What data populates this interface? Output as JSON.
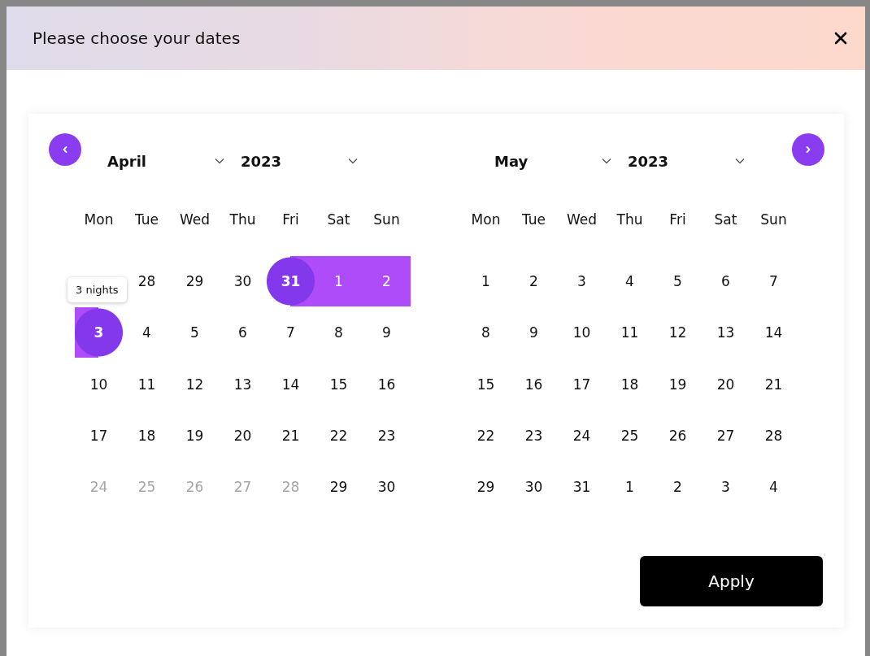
{
  "dialog": {
    "title": "Please choose your dates"
  },
  "months": [
    {
      "month": "April",
      "year": "2023",
      "weekdays": [
        "Mon",
        "Tue",
        "Wed",
        "Thu",
        "Fri",
        "Sat",
        "Sun"
      ],
      "weeks": [
        [
          {
            "kind": "covered"
          },
          {
            "kind": "day",
            "label": "28",
            "selected": false,
            "in_range": false,
            "disabled": false
          },
          {
            "kind": "day",
            "label": "29",
            "selected": false,
            "in_range": false,
            "disabled": false
          },
          {
            "kind": "day",
            "label": "30",
            "selected": false,
            "in_range": false,
            "disabled": false
          },
          {
            "kind": "day",
            "label": "31",
            "selected": true,
            "in_range": true,
            "disabled": false
          },
          {
            "kind": "day",
            "label": "1",
            "selected": false,
            "in_range": true,
            "disabled": false
          },
          {
            "kind": "day",
            "label": "2",
            "selected": false,
            "in_range": true,
            "disabled": false
          }
        ],
        [
          {
            "kind": "day",
            "label": "3",
            "selected": true,
            "in_range": true,
            "disabled": false,
            "tooltip": "3 nights"
          },
          {
            "kind": "day",
            "label": "4",
            "selected": false,
            "in_range": false,
            "disabled": false
          },
          {
            "kind": "day",
            "label": "5",
            "selected": false,
            "in_range": false,
            "disabled": false
          },
          {
            "kind": "day",
            "label": "6",
            "selected": false,
            "in_range": false,
            "disabled": false
          },
          {
            "kind": "day",
            "label": "7",
            "selected": false,
            "in_range": false,
            "disabled": false
          },
          {
            "kind": "day",
            "label": "8",
            "selected": false,
            "in_range": false,
            "disabled": false
          },
          {
            "kind": "day",
            "label": "9",
            "selected": false,
            "in_range": false,
            "disabled": false
          }
        ],
        [
          {
            "kind": "day",
            "label": "10",
            "selected": false,
            "in_range": false,
            "disabled": false
          },
          {
            "kind": "day",
            "label": "11",
            "selected": false,
            "in_range": false,
            "disabled": false
          },
          {
            "kind": "day",
            "label": "12",
            "selected": false,
            "in_range": false,
            "disabled": false
          },
          {
            "kind": "day",
            "label": "13",
            "selected": false,
            "in_range": false,
            "disabled": false
          },
          {
            "kind": "day",
            "label": "14",
            "selected": false,
            "in_range": false,
            "disabled": false
          },
          {
            "kind": "day",
            "label": "15",
            "selected": false,
            "in_range": false,
            "disabled": false
          },
          {
            "kind": "day",
            "label": "16",
            "selected": false,
            "in_range": false,
            "disabled": false
          }
        ],
        [
          {
            "kind": "day",
            "label": "17",
            "selected": false,
            "in_range": false,
            "disabled": false
          },
          {
            "kind": "day",
            "label": "18",
            "selected": false,
            "in_range": false,
            "disabled": false
          },
          {
            "kind": "day",
            "label": "19",
            "selected": false,
            "in_range": false,
            "disabled": false
          },
          {
            "kind": "day",
            "label": "20",
            "selected": false,
            "in_range": false,
            "disabled": false
          },
          {
            "kind": "day",
            "label": "21",
            "selected": false,
            "in_range": false,
            "disabled": false
          },
          {
            "kind": "day",
            "label": "22",
            "selected": false,
            "in_range": false,
            "disabled": false
          },
          {
            "kind": "day",
            "label": "23",
            "selected": false,
            "in_range": false,
            "disabled": false
          }
        ],
        [
          {
            "kind": "day",
            "label": "24",
            "selected": false,
            "in_range": false,
            "disabled": true
          },
          {
            "kind": "day",
            "label": "25",
            "selected": false,
            "in_range": false,
            "disabled": true
          },
          {
            "kind": "day",
            "label": "26",
            "selected": false,
            "in_range": false,
            "disabled": true
          },
          {
            "kind": "day",
            "label": "27",
            "selected": false,
            "in_range": false,
            "disabled": true
          },
          {
            "kind": "day",
            "label": "28",
            "selected": false,
            "in_range": false,
            "disabled": true
          },
          {
            "kind": "day",
            "label": "29",
            "selected": false,
            "in_range": false,
            "disabled": false
          },
          {
            "kind": "day",
            "label": "30",
            "selected": false,
            "in_range": false,
            "disabled": false
          }
        ]
      ]
    },
    {
      "month": "May",
      "year": "2023",
      "weekdays": [
        "Mon",
        "Tue",
        "Wed",
        "Thu",
        "Fri",
        "Sat",
        "Sun"
      ],
      "weeks": [
        [
          {
            "kind": "day",
            "label": "1",
            "selected": false,
            "in_range": false,
            "disabled": false
          },
          {
            "kind": "day",
            "label": "2",
            "selected": false,
            "in_range": false,
            "disabled": false
          },
          {
            "kind": "day",
            "label": "3",
            "selected": false,
            "in_range": false,
            "disabled": false
          },
          {
            "kind": "day",
            "label": "4",
            "selected": false,
            "in_range": false,
            "disabled": false
          },
          {
            "kind": "day",
            "label": "5",
            "selected": false,
            "in_range": false,
            "disabled": false
          },
          {
            "kind": "day",
            "label": "6",
            "selected": false,
            "in_range": false,
            "disabled": false
          },
          {
            "kind": "day",
            "label": "7",
            "selected": false,
            "in_range": false,
            "disabled": false
          }
        ],
        [
          {
            "kind": "day",
            "label": "8",
            "selected": false,
            "in_range": false,
            "disabled": false
          },
          {
            "kind": "day",
            "label": "9",
            "selected": false,
            "in_range": false,
            "disabled": false
          },
          {
            "kind": "day",
            "label": "10",
            "selected": false,
            "in_range": false,
            "disabled": false
          },
          {
            "kind": "day",
            "label": "11",
            "selected": false,
            "in_range": false,
            "disabled": false
          },
          {
            "kind": "day",
            "label": "12",
            "selected": false,
            "in_range": false,
            "disabled": false
          },
          {
            "kind": "day",
            "label": "13",
            "selected": false,
            "in_range": false,
            "disabled": false
          },
          {
            "kind": "day",
            "label": "14",
            "selected": false,
            "in_range": false,
            "disabled": false
          }
        ],
        [
          {
            "kind": "day",
            "label": "15",
            "selected": false,
            "in_range": false,
            "disabled": false
          },
          {
            "kind": "day",
            "label": "16",
            "selected": false,
            "in_range": false,
            "disabled": false
          },
          {
            "kind": "day",
            "label": "17",
            "selected": false,
            "in_range": false,
            "disabled": false
          },
          {
            "kind": "day",
            "label": "18",
            "selected": false,
            "in_range": false,
            "disabled": false
          },
          {
            "kind": "day",
            "label": "19",
            "selected": false,
            "in_range": false,
            "disabled": false
          },
          {
            "kind": "day",
            "label": "20",
            "selected": false,
            "in_range": false,
            "disabled": false
          },
          {
            "kind": "day",
            "label": "21",
            "selected": false,
            "in_range": false,
            "disabled": false
          }
        ],
        [
          {
            "kind": "day",
            "label": "22",
            "selected": false,
            "in_range": false,
            "disabled": false
          },
          {
            "kind": "day",
            "label": "23",
            "selected": false,
            "in_range": false,
            "disabled": false
          },
          {
            "kind": "day",
            "label": "24",
            "selected": false,
            "in_range": false,
            "disabled": false
          },
          {
            "kind": "day",
            "label": "25",
            "selected": false,
            "in_range": false,
            "disabled": false
          },
          {
            "kind": "day",
            "label": "26",
            "selected": false,
            "in_range": false,
            "disabled": false
          },
          {
            "kind": "day",
            "label": "27",
            "selected": false,
            "in_range": false,
            "disabled": false
          },
          {
            "kind": "day",
            "label": "28",
            "selected": false,
            "in_range": false,
            "disabled": false
          }
        ],
        [
          {
            "kind": "day",
            "label": "29",
            "selected": false,
            "in_range": false,
            "disabled": false
          },
          {
            "kind": "day",
            "label": "30",
            "selected": false,
            "in_range": false,
            "disabled": false
          },
          {
            "kind": "day",
            "label": "31",
            "selected": false,
            "in_range": false,
            "disabled": false
          },
          {
            "kind": "day",
            "label": "1",
            "selected": false,
            "in_range": false,
            "disabled": false
          },
          {
            "kind": "day",
            "label": "2",
            "selected": false,
            "in_range": false,
            "disabled": false
          },
          {
            "kind": "day",
            "label": "3",
            "selected": false,
            "in_range": false,
            "disabled": false
          },
          {
            "kind": "day",
            "label": "4",
            "selected": false,
            "in_range": false,
            "disabled": false
          }
        ]
      ]
    }
  ],
  "apply_button": "Apply"
}
